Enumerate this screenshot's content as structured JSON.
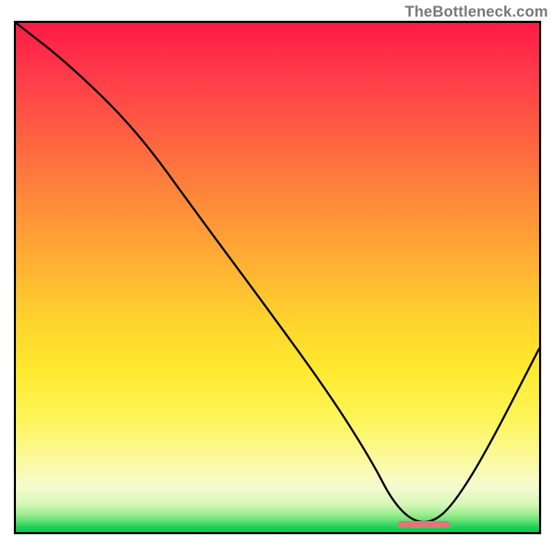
{
  "watermark": "TheBottleneck.com",
  "chart_data": {
    "type": "line",
    "title": "",
    "xlabel": "",
    "ylabel": "",
    "xlim": [
      0,
      100
    ],
    "ylim": [
      0,
      100
    ],
    "grid": false,
    "legend": false,
    "series": [
      {
        "name": "bottleneck-curve",
        "x": [
          0,
          10,
          23,
          35,
          48,
          60,
          68,
          72,
          76,
          80,
          84,
          90,
          100
        ],
        "y": [
          100,
          92,
          79,
          62,
          44,
          27,
          14,
          6,
          2,
          2,
          6,
          16,
          36
        ]
      }
    ],
    "annotations": [
      {
        "name": "optimal-marker",
        "x_start": 73,
        "x_end": 83,
        "y": 1.5
      }
    ],
    "gradient_meaning": "background encodes bottleneck severity: red = high, green = none"
  }
}
